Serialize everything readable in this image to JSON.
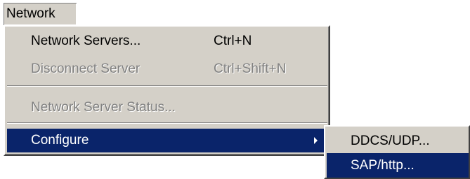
{
  "menubar": {
    "network_label": "Network"
  },
  "menu": {
    "items": [
      {
        "label": "Network Servers...",
        "shortcut": "Ctrl+N"
      },
      {
        "label": "Disconnect Server",
        "shortcut": "Ctrl+Shift+N"
      },
      {
        "label": "Network Server Status..."
      },
      {
        "label": "Configure"
      }
    ]
  },
  "submenu": {
    "items": [
      {
        "label": "DDCS/UDP..."
      },
      {
        "label": "SAP/http..."
      }
    ]
  },
  "colors": {
    "menu_bg": "#d4d0c8",
    "highlight": "#0a246a",
    "disabled_text": "#808080"
  }
}
